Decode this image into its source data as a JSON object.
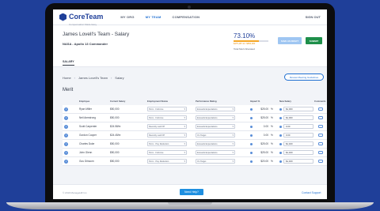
{
  "nav": {
    "logo": "CoreTeam",
    "logo_sub": "Compensation Made Easy",
    "links": [
      "MY ORG",
      "MY TEAM",
      "COMPENSATION"
    ],
    "active": "MY TEAM",
    "signout": "SIGN OUT"
  },
  "header": {
    "title": "James Lovell's Team - Salary",
    "subtitle": "NASA - Apollo 13 Commander",
    "percent": "73.10%",
    "percent_fill": 0.731,
    "percent_line": "$475,187.11 / $650,000",
    "percent_label": "Total Merit Allocated",
    "save_draft": "SAVE AS DRAFT",
    "submit": "SUBMIT",
    "tab": "SALARY"
  },
  "breadcrumb": [
    "Home",
    "James Lovell's Team",
    "Salary"
  ],
  "guide_button": "Review Meeting Guidelines",
  "section": "Merit",
  "columns": [
    "Employee",
    "Current Salary",
    "Employment Status",
    "Performance Rating",
    "Impact %",
    "New Salary",
    "Comments"
  ],
  "rows": [
    {
      "name": "Ryan Miller",
      "salary": "$50,000",
      "status": "Perm - Full-time",
      "rating": "Exceeds Expectations",
      "impact": "$25.00",
      "pct": "%",
      "merit": "$1,000"
    },
    {
      "name": "Neil Armstrong",
      "salary": "$50,000",
      "status": "Perm - Full-time",
      "rating": "Exceeds Expectations",
      "impact": "$25.00",
      "pct": "%",
      "merit": "$1,000"
    },
    {
      "name": "Scott Carpenter",
      "salary": "$24.58/hr",
      "status": "Recently Laid Off",
      "rating": "Exceeds Expectations",
      "impact": "0.00",
      "pct": "%",
      "merit": "0.00"
    },
    {
      "name": "Gordon Cooper",
      "salary": "$24.45/hr",
      "status": "Recently Laid Off",
      "rating": "On Target",
      "impact": "0.00",
      "pct": "%",
      "merit": "0.00"
    },
    {
      "name": "Charles Duke",
      "salary": "$50,000",
      "status": "Perm - Pay Reduction",
      "rating": "Exceeds Expectations",
      "impact": "$25.00",
      "pct": "%",
      "merit": "$1,400"
    },
    {
      "name": "John Glenn",
      "salary": "$50,000",
      "status": "Perm - Full-time",
      "rating": "Exceeds Expectations",
      "impact": "$25.00",
      "pct": "%",
      "merit": "$1,400"
    },
    {
      "name": "Gus Grissom",
      "salary": "$50,000",
      "status": "Perm - Pay Reduction",
      "rating": "On Target",
      "impact": "$20.00",
      "pct": "%",
      "merit": "$1,400"
    }
  ],
  "footer": {
    "copyright": "© 2019 ManageHR Inc.",
    "help": "Need Help?",
    "support": "Contact Support"
  }
}
